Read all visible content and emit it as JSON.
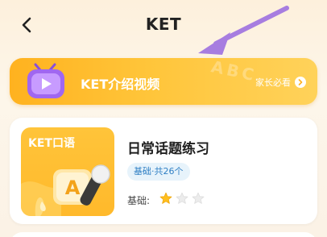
{
  "header": {
    "title": "KET"
  },
  "banner": {
    "title": "KET介绍视频",
    "link_label": "家长必看",
    "deco_text": "ABC"
  },
  "course": {
    "thumb_label": "KET口语",
    "title": "日常话题练习",
    "level_pill": "基础·共26个",
    "rating_label": "基础:",
    "rating_value": 1,
    "rating_max": 3
  },
  "colors": {
    "accent_orange": "#ffb21f",
    "annotation_purple": "#a77de0",
    "pill_bg": "#e7f3fb",
    "pill_text": "#2f7fc4"
  },
  "icons": {
    "back": "chevron-left-icon",
    "video": "tv-play-icon",
    "link": "chevron-right-circle-icon",
    "star": "star-icon",
    "thumb": "letter-a-mic-icon"
  }
}
